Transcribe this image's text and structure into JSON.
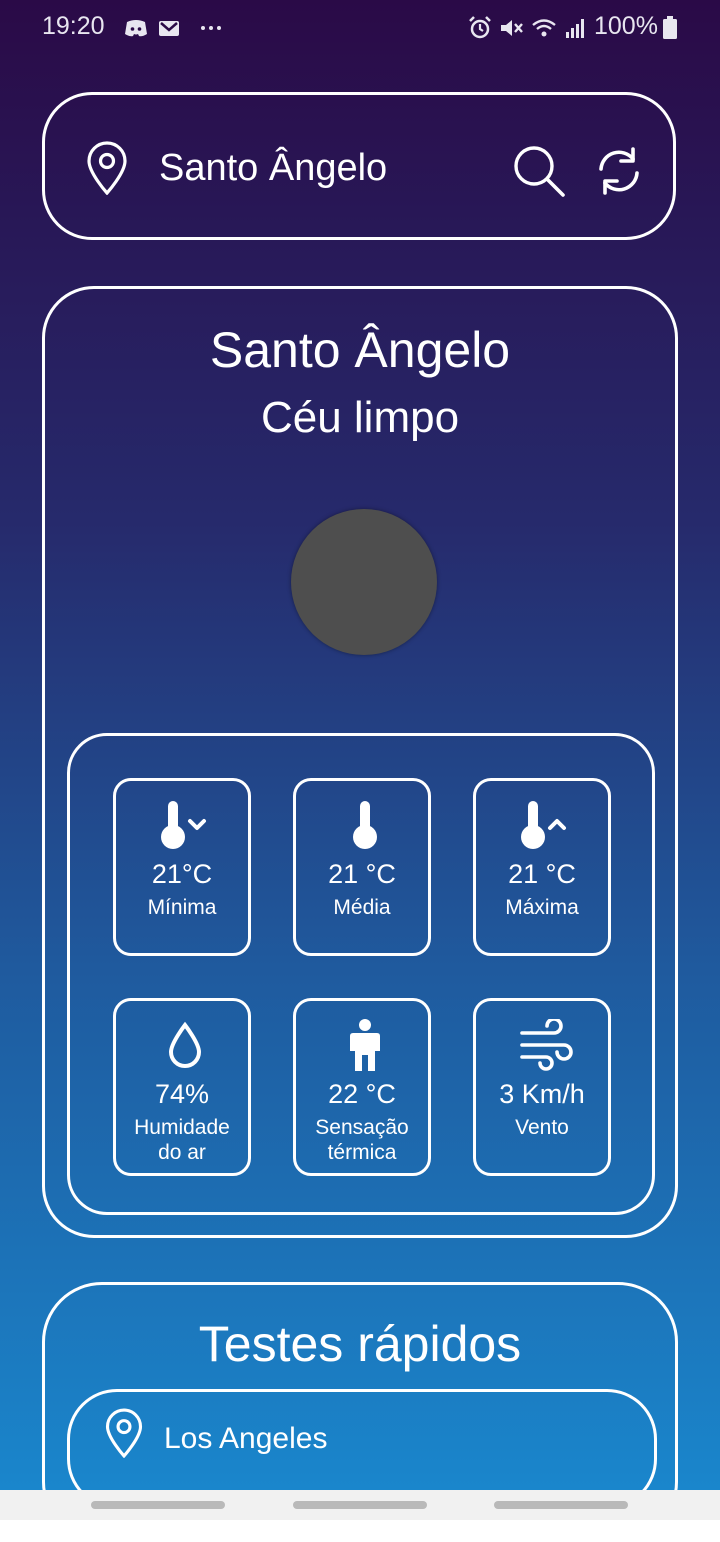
{
  "status_bar": {
    "time": "19:20",
    "battery": "100%",
    "icons": [
      "discord-icon",
      "gmail-icon",
      "more-dots-icon",
      "alarm-icon",
      "mute-icon",
      "wifi-icon",
      "signal-icon",
      "battery-icon"
    ]
  },
  "search": {
    "city": "Santo Ângelo",
    "icons": [
      "location-pin-icon",
      "search-icon",
      "refresh-icon"
    ]
  },
  "weather": {
    "city": "Santo Ângelo",
    "condition": "Céu limpo",
    "tiles": [
      {
        "value": "21°C",
        "label": "Mínima",
        "icon": "thermometer-down-icon"
      },
      {
        "value": "21 °C",
        "label": "Média",
        "icon": "thermometer-icon"
      },
      {
        "value": "21 °C",
        "label": "Máxima",
        "icon": "thermometer-up-icon"
      },
      {
        "value": "74%",
        "label_line1": "Humidade",
        "label_line2": "do ar",
        "icon": "water-drop-icon"
      },
      {
        "value": "22 °C",
        "label_line1": "Sensação",
        "label_line2": "térmica",
        "icon": "person-icon"
      },
      {
        "value": "3 Km/h",
        "label": "Vento",
        "icon": "wind-icon"
      }
    ]
  },
  "quick_tests": {
    "title": "Testes rápidos",
    "items": [
      {
        "label": "Los Angeles"
      }
    ]
  },
  "colors": {
    "gradient_top": "#2a0a47",
    "gradient_bottom": "#1a86cc",
    "icon_placeholder": "#4e4e4e"
  }
}
